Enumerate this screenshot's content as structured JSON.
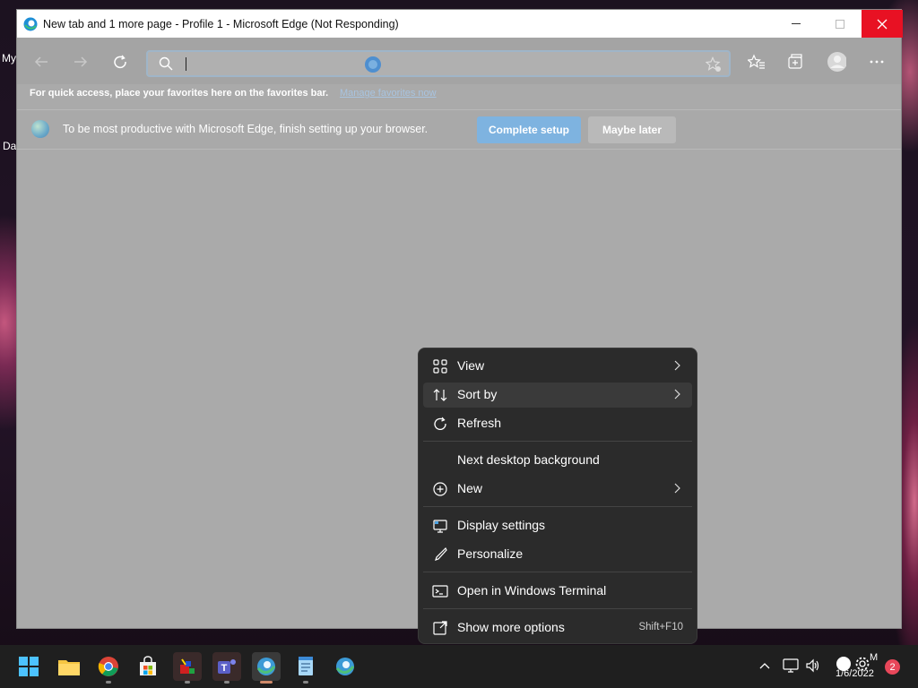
{
  "desktop": {
    "labels": [
      "My",
      "Da"
    ]
  },
  "window": {
    "title": "New tab and 1 more page - Profile 1 - Microsoft Edge (Not Responding)"
  },
  "favorites_bar": {
    "text": "For quick access, place your favorites here on the favorites bar.",
    "link": "Manage favorites now"
  },
  "setup_bar": {
    "text": "To be most productive with Microsoft Edge, finish setting up your browser.",
    "complete_label": "Complete setup",
    "later_label": "Maybe later"
  },
  "context_menu": {
    "items": [
      {
        "label": "View",
        "icon": "grid-icon",
        "arrow": true
      },
      {
        "label": "Sort by",
        "icon": "sort-icon",
        "arrow": true
      },
      {
        "label": "Refresh",
        "icon": "refresh-icon",
        "arrow": false
      },
      {
        "label": "Next desktop background",
        "icon": "",
        "arrow": false
      },
      {
        "label": "New",
        "icon": "plus-circle-icon",
        "arrow": true
      },
      {
        "label": "Display settings",
        "icon": "display-icon",
        "arrow": false
      },
      {
        "label": "Personalize",
        "icon": "brush-icon",
        "arrow": false
      },
      {
        "label": "Open in Windows Terminal",
        "icon": "terminal-icon",
        "arrow": false
      },
      {
        "label": "Show more options",
        "icon": "share-icon",
        "arrow": false,
        "shortcut": "Shift+F10"
      }
    ]
  },
  "taskbar": {
    "date": "1/6/2022",
    "tray_letter": "M",
    "notification_count": "2"
  },
  "colors": {
    "close_button": "#e81123",
    "accent": "#7eb3e0",
    "menu_bg": "#2b2b2b",
    "badge": "#e8475a"
  }
}
